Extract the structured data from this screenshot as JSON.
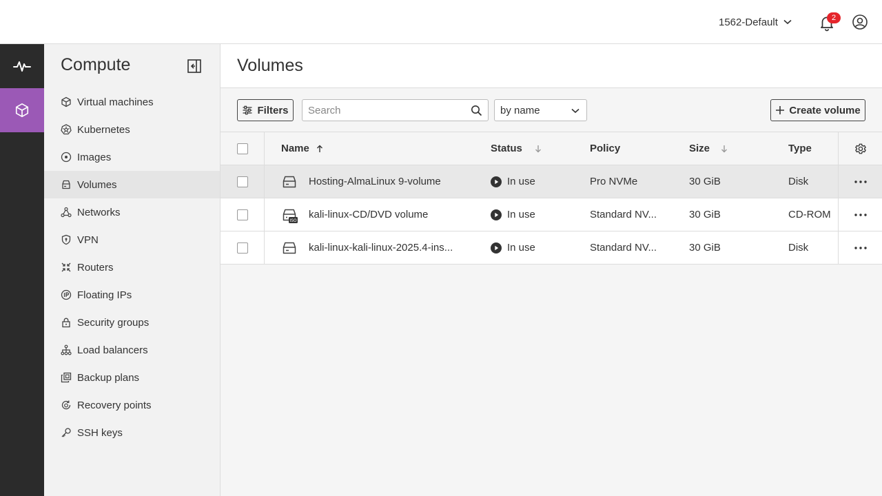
{
  "topbar": {
    "project_name": "1562-Default",
    "notifications_count": "2"
  },
  "sidebar": {
    "title": "Compute",
    "items": [
      {
        "label": "Virtual machines",
        "icon": "cube-icon"
      },
      {
        "label": "Kubernetes",
        "icon": "kubernetes-icon"
      },
      {
        "label": "Images",
        "icon": "disc-icon"
      },
      {
        "label": "Volumes",
        "icon": "volume-icon",
        "active": true
      },
      {
        "label": "Networks",
        "icon": "network-icon"
      },
      {
        "label": "VPN",
        "icon": "shield-icon"
      },
      {
        "label": "Routers",
        "icon": "router-icon"
      },
      {
        "label": "Floating IPs",
        "icon": "floating-ip-icon"
      },
      {
        "label": "Security groups",
        "icon": "lock-icon"
      },
      {
        "label": "Load balancers",
        "icon": "load-balancer-icon"
      },
      {
        "label": "Backup plans",
        "icon": "backup-icon"
      },
      {
        "label": "Recovery points",
        "icon": "recovery-icon"
      },
      {
        "label": "SSH keys",
        "icon": "key-icon"
      }
    ]
  },
  "main": {
    "title": "Volumes",
    "toolbar": {
      "filters_label": "Filters",
      "search_placeholder": "Search",
      "sort_value": "by name",
      "create_label": "Create volume"
    },
    "table": {
      "columns": {
        "name": "Name",
        "status": "Status",
        "policy": "Policy",
        "size": "Size",
        "type": "Type"
      },
      "rows": [
        {
          "name": "Hosting-AlmaLinux 9-volume",
          "status": "In use",
          "policy": "Pro NVMe",
          "size": "30 GiB",
          "type": "Disk",
          "icon": "disk-icon"
        },
        {
          "name": "kali-linux-CD/DVD volume",
          "status": "In use",
          "policy": "Standard NV...",
          "size": "30 GiB",
          "type": "CD-ROM",
          "icon": "iso-disk-icon"
        },
        {
          "name": "kali-linux-kali-linux-2025.4-ins...",
          "status": "In use",
          "policy": "Standard NV...",
          "size": "30 GiB",
          "type": "Disk",
          "icon": "disk-icon"
        }
      ]
    }
  },
  "colors": {
    "accent": "#9b59b6",
    "rail": "#2b2b2b",
    "badge": "#e5242b"
  }
}
